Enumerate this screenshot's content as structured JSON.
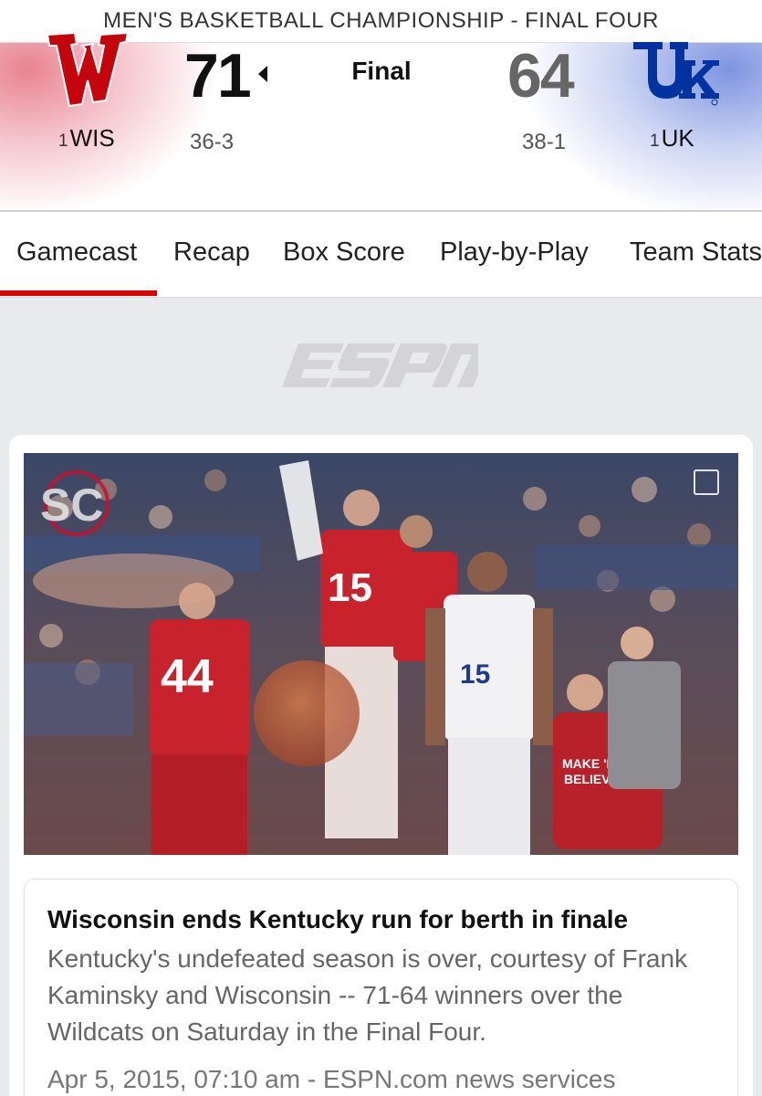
{
  "event": {
    "title": "MEN'S BASKETBALL CHAMPIONSHIP - FINAL FOUR"
  },
  "game": {
    "status": "Final",
    "home": {
      "seed": "1",
      "abbr": "WIS",
      "score": "71",
      "record": "36-3",
      "logo": "wisconsin-w-logo",
      "color": "#c5050c",
      "winner": true
    },
    "away": {
      "seed": "1",
      "abbr": "UK",
      "score": "64",
      "record": "38-1",
      "logo": "kentucky-uk-logo",
      "color": "#0033a0"
    }
  },
  "tabs": [
    {
      "label": "Gamecast",
      "active": true
    },
    {
      "label": "Recap"
    },
    {
      "label": "Box Score"
    },
    {
      "label": "Play-by-Play"
    },
    {
      "label": "Team Stats"
    }
  ],
  "branding": {
    "logo": "ESPN",
    "watermark": "SC"
  },
  "story": {
    "image": "wisconsin-players-celebrating-photo",
    "headline": "Wisconsin ends Kentucky run for berth in finale",
    "summary": "Kentucky's undefeated season is over, courtesy of Frank Kaminsky and Wisconsin -- 71-64 winners over the Wildcats on Saturday in the Final Four.",
    "meta": "Apr 5, 2015, 07:10 am - ESPN.com news services"
  },
  "colors": {
    "accent": "#d00000",
    "wisconsin": "#c5050c",
    "kentucky": "#0033a0"
  }
}
